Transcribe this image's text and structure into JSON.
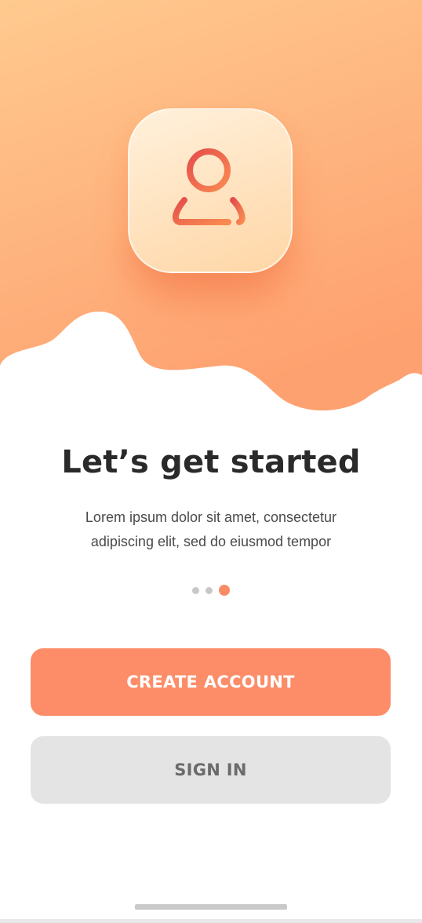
{
  "hero": {
    "icon": "user-icon",
    "gradient_top": "#ffc98d",
    "gradient_bottom": "#fe9e70"
  },
  "content": {
    "title": "Let’s get started",
    "subtitle_line1": "Lorem ipsum dolor sit amet, consectetur",
    "subtitle_line2": "adipiscing elit, sed do eiusmod tempor"
  },
  "pagination": {
    "total": 3,
    "active_index": 2,
    "active_color": "#fa8c64"
  },
  "actions": {
    "create_account_label": "CREATE ACCOUNT",
    "sign_in_label": "SIGN IN"
  },
  "colors": {
    "accent": "#fc8d68",
    "secondary_button": "#e4e4e4",
    "icon_stroke": "#ec5c4e"
  }
}
